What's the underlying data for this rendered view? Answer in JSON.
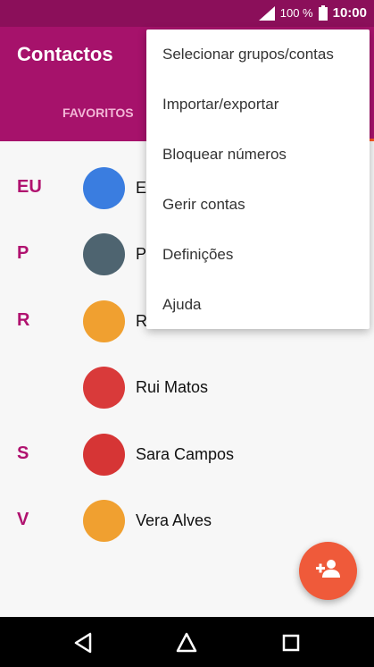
{
  "status": {
    "battery_text": "100 %",
    "time": "10:00"
  },
  "app_bar": {
    "title": "Contactos",
    "tab_favoritos": "FAVORITOS"
  },
  "contacts": [
    {
      "letter": "EU",
      "name": "E",
      "avatar_color": "#3a7de0"
    },
    {
      "letter": "P",
      "name": "P",
      "avatar_color": "#4e6470"
    },
    {
      "letter": "R",
      "name": "R",
      "avatar_color": "#f0a030"
    },
    {
      "letter": "",
      "name": "Rui Matos",
      "avatar_color": "#d93a3a"
    },
    {
      "letter": "S",
      "name": "Sara Campos",
      "avatar_color": "#d63535"
    },
    {
      "letter": "V",
      "name": "Vera Alves",
      "avatar_color": "#f0a030"
    }
  ],
  "menu": {
    "items": [
      "Selecionar grupos/contas",
      "Importar/exportar",
      "Bloquear números",
      "Gerir contas",
      "Definições",
      "Ajuda"
    ]
  },
  "fab": {
    "icon": "add-contact-icon"
  },
  "nav": {
    "back_icon": "back-icon",
    "home_icon": "home-icon",
    "recents_icon": "recents-icon"
  },
  "colors": {
    "status_bar": "#8b0f5a",
    "app_bar": "#a6126b",
    "accent": "#ff5722",
    "fab": "#ef5a3a",
    "section_letter": "#b0126f"
  }
}
